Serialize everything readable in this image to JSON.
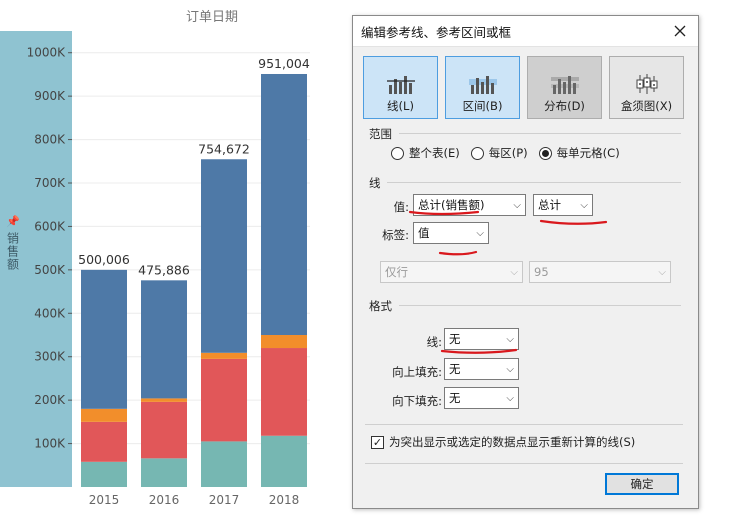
{
  "chart": {
    "column_header": "订单日期",
    "y_axis_title": "销售额",
    "y_ticks": [
      "100K",
      "200K",
      "300K",
      "400K",
      "500K",
      "600K",
      "700K",
      "800K",
      "900K",
      "1000K"
    ],
    "colors": {
      "seg1": "#76b7b2",
      "seg2": "#e15759",
      "seg3": "#f28e2b",
      "seg4": "#4e79a7",
      "axis_band": "#8fc3d1"
    }
  },
  "chart_data": {
    "type": "bar",
    "stacked": true,
    "categories": [
      "2015",
      "2016",
      "2017",
      "2018"
    ],
    "totals": [
      "500,006",
      "475,886",
      "754,672",
      "951,004"
    ],
    "series": [
      {
        "values": [
          58000,
          66000,
          105000,
          118000
        ]
      },
      {
        "values": [
          92000,
          130000,
          190000,
          202000
        ]
      },
      {
        "values": [
          30000,
          8000,
          14000,
          30000
        ]
      },
      {
        "values": [
          320006,
          271886,
          445672,
          601004
        ]
      }
    ],
    "ylim": [
      0,
      1050000
    ],
    "grid": true,
    "legend": "none"
  },
  "dialog": {
    "title": "编辑参考线、参考区间或框",
    "type_buttons": [
      {
        "label": "线(L)",
        "icon": "line-icon"
      },
      {
        "label": "区间(B)",
        "icon": "band-icon"
      },
      {
        "label": "分布(D)",
        "icon": "distribution-icon"
      },
      {
        "label": "盒须图(X)",
        "icon": "boxplot-icon"
      }
    ],
    "scope": {
      "label": "范围",
      "options": [
        "整个表(E)",
        "每区(P)",
        "每单元格(C)"
      ],
      "selected": "每单元格(C)"
    },
    "line": {
      "label": "线",
      "value_label": "值:",
      "value_field": "总计(销售额)",
      "aggregation": "总计",
      "tag_label": "标签:",
      "tag_value": "值",
      "tooltip_mode": "仅行",
      "confidence": "95"
    },
    "format": {
      "label": "格式",
      "line_label": "线:",
      "line_value": "无",
      "fill_above_label": "向上填充:",
      "fill_above_value": "无",
      "fill_below_label": "向下填充:",
      "fill_below_value": "无"
    },
    "recalc_checkbox": "为突出显示或选定的数据点显示重新计算的线(S)",
    "ok_button": "确定"
  }
}
